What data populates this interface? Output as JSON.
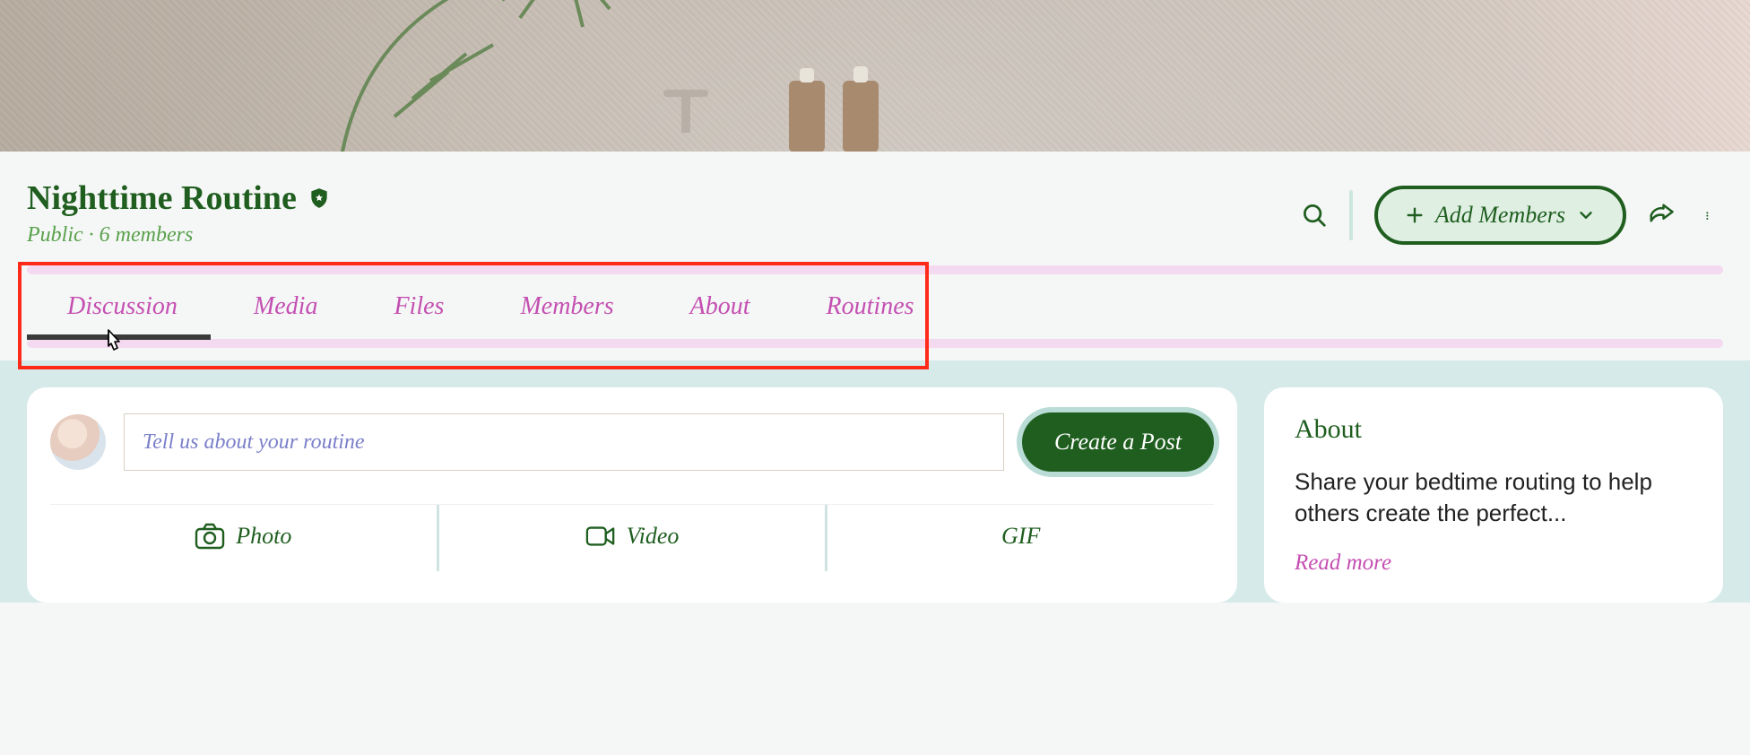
{
  "group": {
    "title": "Nighttime Routine",
    "visibility": "Public",
    "members_label": "6 members"
  },
  "header": {
    "add_members_label": "Add Members"
  },
  "tabs": [
    {
      "label": "Discussion",
      "active": true
    },
    {
      "label": "Media"
    },
    {
      "label": "Files"
    },
    {
      "label": "Members"
    },
    {
      "label": "About"
    },
    {
      "label": "Routines"
    }
  ],
  "compose": {
    "placeholder": "Tell us about your routine",
    "create_label": "Create a Post",
    "photo_label": "Photo",
    "video_label": "Video",
    "gif_label": "GIF"
  },
  "about": {
    "title": "About",
    "text": "Share your bedtime routing to help others create the perfect...",
    "read_more": "Read more"
  }
}
